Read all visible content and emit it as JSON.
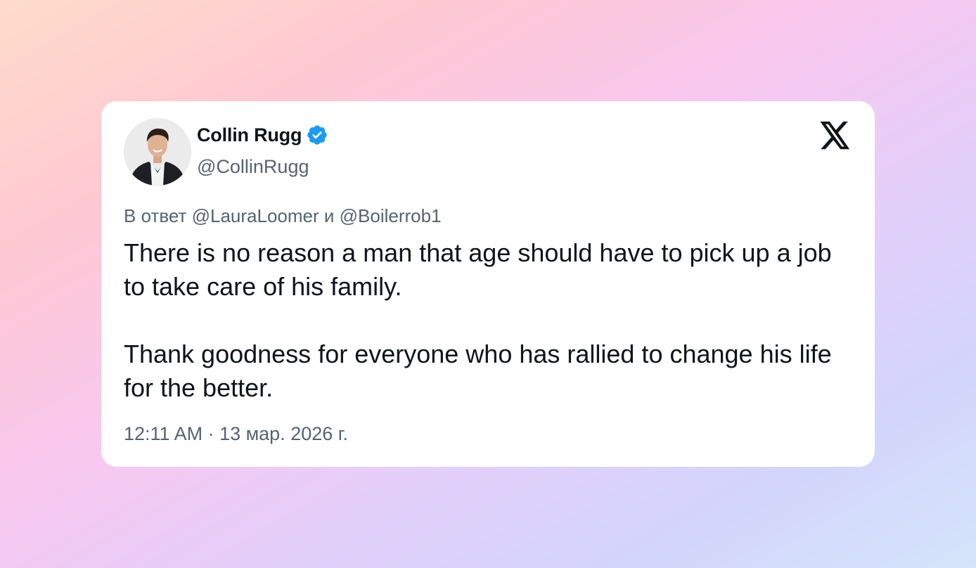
{
  "card": {
    "author": {
      "display_name": "Collin Rugg",
      "handle": "@CollinRugg",
      "verified_color": "#1d9bf0",
      "avatar_icon": "profile-photo"
    },
    "brand_icon": "x-logo-icon",
    "reply_to": "В ответ @LauraLoomer и @Boilerrob1",
    "text": {
      "paragraph_1": "There is no reason a man that age should have to pick up a job to take care of his family.",
      "paragraph_2": "Thank goodness for everyone who has rallied to change his life for the better."
    },
    "timestamp": "12:11 AM · 13 мар. 2026 г."
  },
  "colors": {
    "text_primary": "#0f1419",
    "text_secondary": "#536471",
    "card_background": "#ffffff"
  }
}
